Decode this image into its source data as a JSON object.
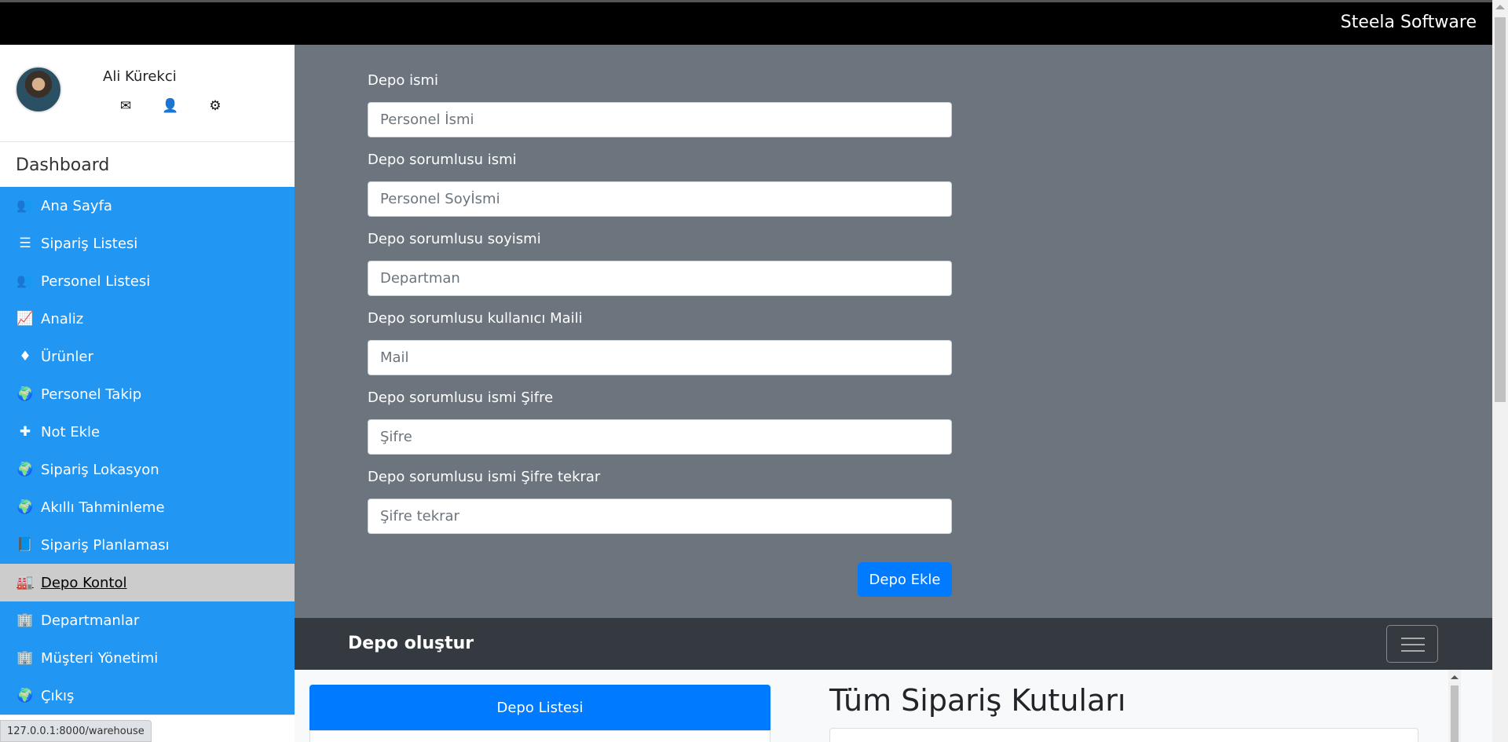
{
  "header": {
    "brand": "Steela Software"
  },
  "profile": {
    "name": "Ali Kürekci",
    "icons": [
      "envelope-icon",
      "user-icon",
      "gear-icon"
    ]
  },
  "sidebar": {
    "title": "Dashboard",
    "items": [
      {
        "label": "Ana Sayfa",
        "icon": "users-icon",
        "glyph": "👥"
      },
      {
        "label": "Sipariş Listesi",
        "icon": "list-icon",
        "glyph": "☰"
      },
      {
        "label": "Personel Listesi",
        "icon": "users-icon",
        "glyph": "👥"
      },
      {
        "label": "Analiz",
        "icon": "line-chart-icon",
        "glyph": "📈"
      },
      {
        "label": "Ürünler",
        "icon": "diamond-icon",
        "glyph": "♦"
      },
      {
        "label": "Personel Takip",
        "icon": "globe-icon",
        "glyph": "🌍"
      },
      {
        "label": "Not Ekle",
        "icon": "plus-icon",
        "glyph": "✚"
      },
      {
        "label": "Sipariş Lokasyon",
        "icon": "globe-icon",
        "glyph": "🌍"
      },
      {
        "label": "Akıllı Tahminleme",
        "icon": "globe-icon",
        "glyph": "🌍"
      },
      {
        "label": "Sipariş Planlaması",
        "icon": "book-icon",
        "glyph": "📘"
      },
      {
        "label": "Depo Kontol",
        "icon": "industry-icon",
        "glyph": "🏭",
        "active": true
      },
      {
        "label": "Departmanlar",
        "icon": "building-icon",
        "glyph": "🏢"
      },
      {
        "label": "Müşteri Yönetimi",
        "icon": "building-icon",
        "glyph": "🏢"
      },
      {
        "label": "Çıkış",
        "icon": "globe-icon",
        "glyph": "🌍"
      }
    ]
  },
  "form": {
    "fields": [
      {
        "label": "Depo ismi",
        "placeholder": "Personel İsmi"
      },
      {
        "label": "Depo sorumlusu ismi",
        "placeholder": "Personel Soyİsmi"
      },
      {
        "label": "Depo sorumlusu soyismi",
        "placeholder": "Departman"
      },
      {
        "label": "Depo sorumlusu kullanıcı Maili",
        "placeholder": "Mail"
      },
      {
        "label": "Depo sorumlusu ismi Şifre",
        "placeholder": "Şifre"
      },
      {
        "label": "Depo sorumlusu ismi Şifre tekrar",
        "placeholder": "Şifre tekrar"
      }
    ],
    "submit_label": "Depo Ekle"
  },
  "navbar": {
    "title": "Depo oluştur"
  },
  "panels": {
    "list_button": "Depo Listesi",
    "orders_title": "Tüm Sipariş Kutuları"
  },
  "statusbar": {
    "url": "127.0.0.1:8000/warehouse"
  },
  "colors": {
    "sidebar_blue": "#2196f3",
    "active_gray": "#cccccc",
    "form_bg": "#6c757d",
    "primary": "#007bff",
    "dark_nav": "#343a40"
  }
}
